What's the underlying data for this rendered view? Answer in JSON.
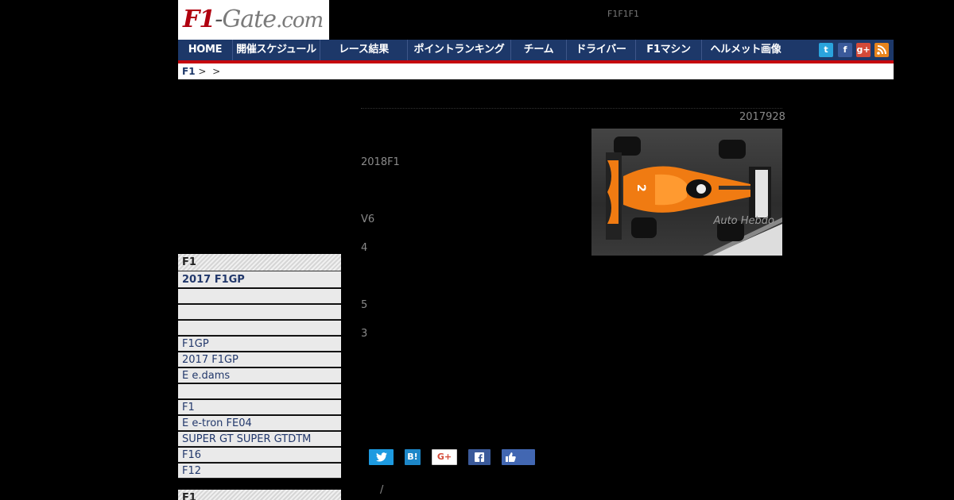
{
  "site": {
    "logo_f1": "F1",
    "logo_dash": "-",
    "logo_gate": "Gate",
    "logo_com": ".com",
    "tagline": "F1F1F1"
  },
  "nav": {
    "items": [
      "HOME",
      "開催スケジュール",
      "レース結果",
      "ポイントランキング",
      "チーム",
      "ドライバー",
      "F1マシン",
      "ヘルメット画像"
    ],
    "social": [
      "twitter-icon",
      "facebook-icon",
      "google-plus-icon",
      "rss-icon"
    ]
  },
  "breadcrumb": {
    "home": "F1",
    "sep1": ">",
    "sep2": ">"
  },
  "sidebar": {
    "box1": {
      "title": "F1",
      "featured": "2017 F1GP",
      "items": [
        "",
        "",
        "",
        "F1GP",
        "2017 F1GP",
        "E  e.dams",
        "",
        "F1",
        "E e-tron FE04",
        "SUPER GT SUPER GTDTM",
        "F16",
        "F12"
      ]
    },
    "box2": {
      "title": "F1"
    }
  },
  "article": {
    "date": "2017928",
    "paragraphs": [
      "2018F1",
      "V6",
      "4",
      "5",
      "3"
    ],
    "photo_credit": "Auto Hebdo",
    "share": [
      "twitter",
      "B!",
      "G+",
      "facebook",
      "like"
    ],
    "footer_slash": "/"
  },
  "colors": {
    "nav_bg": "#1d3869",
    "nav_accent": "#c5080f",
    "logo_red": "#b0000f",
    "car_orange": "#f07b12"
  }
}
